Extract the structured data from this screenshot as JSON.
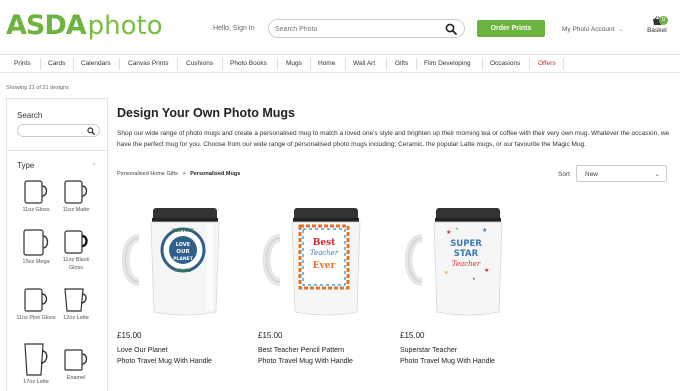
{
  "header": {
    "logo_asda": "ASDA",
    "logo_photo": "photo",
    "hello": "Hello, Sign In",
    "search_placeholder": "Search Photo",
    "order_prints": "Order Prints",
    "account": "My Photo Account",
    "account_chevron": "⌄",
    "basket": "Basket",
    "basket_count": "0"
  },
  "nav": {
    "items": [
      "Prints",
      "Cards",
      "Calendars",
      "Canvas Prints",
      "Cushions",
      "Photo Books",
      "Mugs",
      "Home",
      "Wall Art",
      "Gifts",
      "Film Developing",
      "Occasions",
      "Offers"
    ]
  },
  "showing": "Showing 21 of 21 designs",
  "sidebar": {
    "search_title": "Search",
    "type_title": "Type",
    "type_chevron": "⌃",
    "types": [
      "11oz Gloss",
      "11oz Matte",
      "15oz Mega",
      "11oz Black Gloss",
      "11oz Pink Gloss",
      "12oz Latte",
      "17oz Latte",
      "Enamel"
    ]
  },
  "main": {
    "title": "Design Your Own Photo Mugs",
    "intro": "Shop our wide range of photo mugs and create a personalised mug to match a loved one's style and brighten up their morning tea or coffee with their very own mug. Whatever the occasion, we have the perfect mug for you. Choose from our wide range of personalised photo mugs including; Ceramic, the popular Latte mugs, or our favourite the Magic Mug.",
    "breadcrumb": {
      "parent": "Personalised Home Gifts",
      "separator": ">",
      "current": "Personalised Mugs"
    },
    "sort_label": "Sort",
    "sort_value": "New",
    "sort_chevron": "⌄"
  },
  "products": [
    {
      "price": "£15.00",
      "name": "Love Our Planet",
      "subtitle": "Photo Travel Mug With Handle",
      "art_lines": [
        "RECYCLE",
        "LOVE",
        "OUR",
        "PLANET",
        "REUSE"
      ]
    },
    {
      "price": "£15.00",
      "name": "Best Teacher Pencil Pattern",
      "subtitle": "Photo Travel Mug With Handle",
      "art_lines": [
        "Best",
        "Teacher",
        "Ever"
      ]
    },
    {
      "price": "£15.00",
      "name": "Superstar Teacher",
      "subtitle": "Photo Travel Mug With Handle",
      "art_lines": [
        "SUPER",
        "STAR",
        "Teacher"
      ]
    }
  ],
  "colors": {
    "brand_green": "#6cb33f",
    "offers_red": "#d9242b",
    "planet_blue": "#2f5f8a",
    "teacher_orange": "#e2732a"
  },
  "icons": {
    "search": "search-icon",
    "basket": "basket-icon",
    "mug": "mug-icon"
  }
}
